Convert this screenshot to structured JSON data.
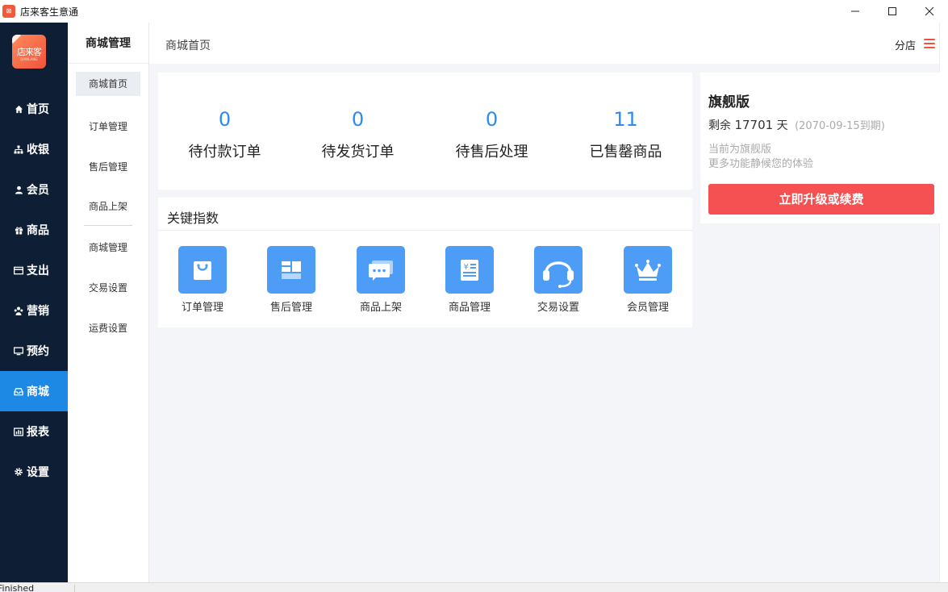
{
  "window": {
    "title": "店来客生意通"
  },
  "app_logo": {
    "text": "店来客",
    "subtext": "DIANLAIKE"
  },
  "nav": [
    {
      "label": "首页",
      "icon": "home-icon"
    },
    {
      "label": "收银",
      "icon": "cashier-icon"
    },
    {
      "label": "会员",
      "icon": "user-icon"
    },
    {
      "label": "商品",
      "icon": "gift-icon"
    },
    {
      "label": "支出",
      "icon": "card-icon"
    },
    {
      "label": "营销",
      "icon": "marketing-icon"
    },
    {
      "label": "预约",
      "icon": "monitor-icon"
    },
    {
      "label": "商城",
      "icon": "mall-icon",
      "active": true
    },
    {
      "label": "报表",
      "icon": "chart-icon"
    },
    {
      "label": "设置",
      "icon": "gear-icon"
    }
  ],
  "subnav": {
    "title": "商城管理",
    "items": [
      "商城首页",
      "订单管理",
      "售后管理",
      "商品上架",
      "商城管理",
      "交易设置",
      "运费设置"
    ]
  },
  "header": {
    "breadcrumb": "商城首页",
    "branch": "分店"
  },
  "stats": [
    {
      "value": "0",
      "label": "待付款订单"
    },
    {
      "value": "0",
      "label": "待发货订单"
    },
    {
      "value": "0",
      "label": "待售后处理"
    },
    {
      "value": "11",
      "label": "已售罄商品"
    }
  ],
  "key_metrics": {
    "title": "关键指数",
    "tiles": [
      {
        "label": "订单管理",
        "icon": "bag-icon"
      },
      {
        "label": "售后管理",
        "icon": "layout-icon"
      },
      {
        "label": "商品上架",
        "icon": "chat-icon"
      },
      {
        "label": "商品管理",
        "icon": "invoice-icon"
      },
      {
        "label": "交易设置",
        "icon": "headset-icon"
      },
      {
        "label": "会员管理",
        "icon": "crown-icon"
      }
    ]
  },
  "vip": {
    "title": "旗舰版",
    "days_prefix": "剩余",
    "days": "17701",
    "days_suffix": "天",
    "expiry": "(2070-09-15到期)",
    "note1": "当前为旗舰版",
    "note2": "更多功能静候您的体验",
    "button": "立即升级或续费"
  },
  "status": {
    "text": "Finished"
  },
  "colors": {
    "accent": "#1e88e5",
    "nav_bg": "#0e1f35",
    "stat_number": "#2a8cf0",
    "tile": "#4d9cf6",
    "upgrade_button": "#f55152"
  }
}
